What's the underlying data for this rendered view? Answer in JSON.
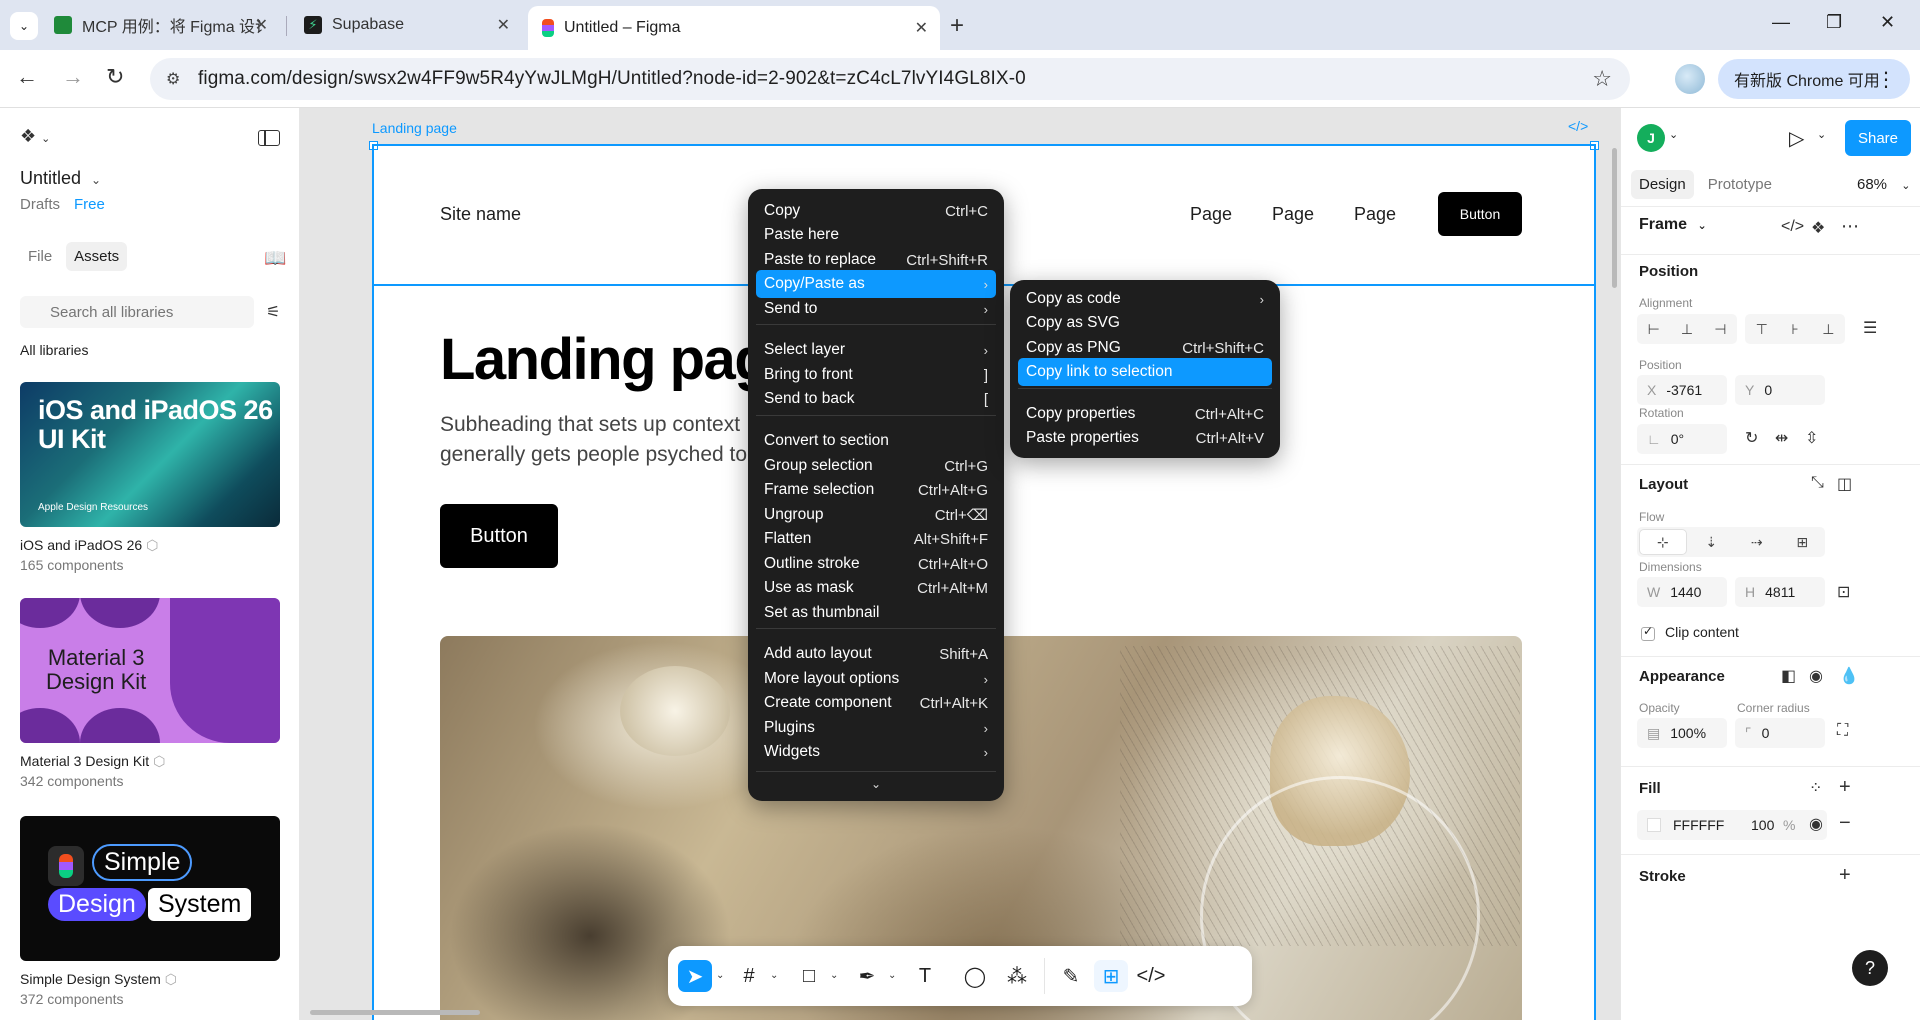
{
  "browser": {
    "tabs": [
      {
        "title": "MCP 用例：将 Figma 设计稿转",
        "active": false,
        "color": "#1f8a3a"
      },
      {
        "title": "Supabase",
        "active": false,
        "color": "#3ecf8e"
      },
      {
        "title": "Untitled – Figma",
        "active": true,
        "color": "#f24e1e"
      }
    ],
    "url": "figma.com/design/swsx2w4FF9w5R4yYwJLMgH/Untitled?node-id=2-902&t=zC4cL7lvYI4GL8IX-0",
    "update_label": "有新版 Chrome 可用"
  },
  "left_panel": {
    "file_title": "Untitled",
    "drafts": "Drafts",
    "plan": "Free",
    "tabs": [
      "File",
      "Assets"
    ],
    "search_placeholder": "Search all libraries",
    "all_libraries": "All libraries",
    "libraries": [
      {
        "name": "iOS and iPadOS 26",
        "count": "165 components",
        "cover_title": "iOS and iPadOS 26\nUI Kit",
        "cover_sub": "Apple Design Resources"
      },
      {
        "name": "Material 3 Design Kit",
        "count": "342 components",
        "cover_title": "Material 3\nDesign Kit"
      },
      {
        "name": "Simple Design System",
        "count": "372 components",
        "cover_words": [
          "Simple",
          "Design",
          "System"
        ]
      }
    ]
  },
  "canvas": {
    "frame_label": "Landing page",
    "site_name": "Site name",
    "nav": [
      "Page",
      "Page",
      "Page"
    ],
    "header_button": "Button",
    "hero_title": "Landing pag",
    "hero_sub_1": "Subheading that sets up context",
    "hero_sub_2": "generally gets people psyched to",
    "hero_button": "Button"
  },
  "context_menu": {
    "items": [
      {
        "label": "Copy",
        "shortcut": "Ctrl+C"
      },
      {
        "label": "Paste here",
        "shortcut": ""
      },
      {
        "label": "Paste to replace",
        "shortcut": "Ctrl+Shift+R"
      },
      {
        "label": "Copy/Paste as",
        "shortcut": "›",
        "highlight": true
      },
      {
        "label": "Send to",
        "shortcut": "›"
      },
      {
        "label": "Select layer",
        "shortcut": "›"
      },
      {
        "label": "Bring to front",
        "shortcut": "]"
      },
      {
        "label": "Send to back",
        "shortcut": "["
      },
      {
        "label": "Convert to section",
        "shortcut": ""
      },
      {
        "label": "Group selection",
        "shortcut": "Ctrl+G"
      },
      {
        "label": "Frame selection",
        "shortcut": "Ctrl+Alt+G"
      },
      {
        "label": "Ungroup",
        "shortcut": "Ctrl+⌫"
      },
      {
        "label": "Flatten",
        "shortcut": "Alt+Shift+F"
      },
      {
        "label": "Outline stroke",
        "shortcut": "Ctrl+Alt+O"
      },
      {
        "label": "Use as mask",
        "shortcut": "Ctrl+Alt+M"
      },
      {
        "label": "Set as thumbnail",
        "shortcut": ""
      },
      {
        "label": "Add auto layout",
        "shortcut": "Shift+A"
      },
      {
        "label": "More layout options",
        "shortcut": "›"
      },
      {
        "label": "Create component",
        "shortcut": "Ctrl+Alt+K"
      },
      {
        "label": "Plugins",
        "shortcut": "›"
      },
      {
        "label": "Widgets",
        "shortcut": "›"
      }
    ],
    "more_indicator": "⌄"
  },
  "submenu": {
    "items": [
      {
        "label": "Copy as code",
        "shortcut": "›"
      },
      {
        "label": "Copy as SVG",
        "shortcut": ""
      },
      {
        "label": "Copy as PNG",
        "shortcut": "Ctrl+Shift+C"
      },
      {
        "label": "Copy link to selection",
        "shortcut": "",
        "highlight": true
      },
      {
        "label": "Copy properties",
        "shortcut": "Ctrl+Alt+C"
      },
      {
        "label": "Paste properties",
        "shortcut": "Ctrl+Alt+V"
      }
    ]
  },
  "right_panel": {
    "avatar": "J",
    "share": "Share",
    "tabs": [
      "Design",
      "Prototype"
    ],
    "zoom": "68%",
    "frame_type": "Frame",
    "position_section": "Position",
    "alignment_label": "Alignment",
    "position_label": "Position",
    "x_prefix": "X",
    "x_value": "-3761",
    "y_prefix": "Y",
    "y_value": "0",
    "rotation_label": "Rotation",
    "rotation_value": "0°",
    "layout_section": "Layout",
    "flow_label": "Flow",
    "dimensions_label": "Dimensions",
    "w_prefix": "W",
    "w_value": "1440",
    "h_prefix": "H",
    "h_value": "4811",
    "clip_content": "Clip content",
    "appearance_section": "Appearance",
    "opacity_label": "Opacity",
    "opacity_value": "100%",
    "corner_label": "Corner radius",
    "corner_value": "0",
    "fill_section": "Fill",
    "fill_hex": "FFFFFF",
    "fill_opacity": "100",
    "fill_pct": "%",
    "stroke_section": "Stroke",
    "help": "?"
  },
  "colors": {
    "accent": "#0d99ff",
    "menu_bg": "#1e1e1e",
    "avatar": "#14ae5c"
  }
}
